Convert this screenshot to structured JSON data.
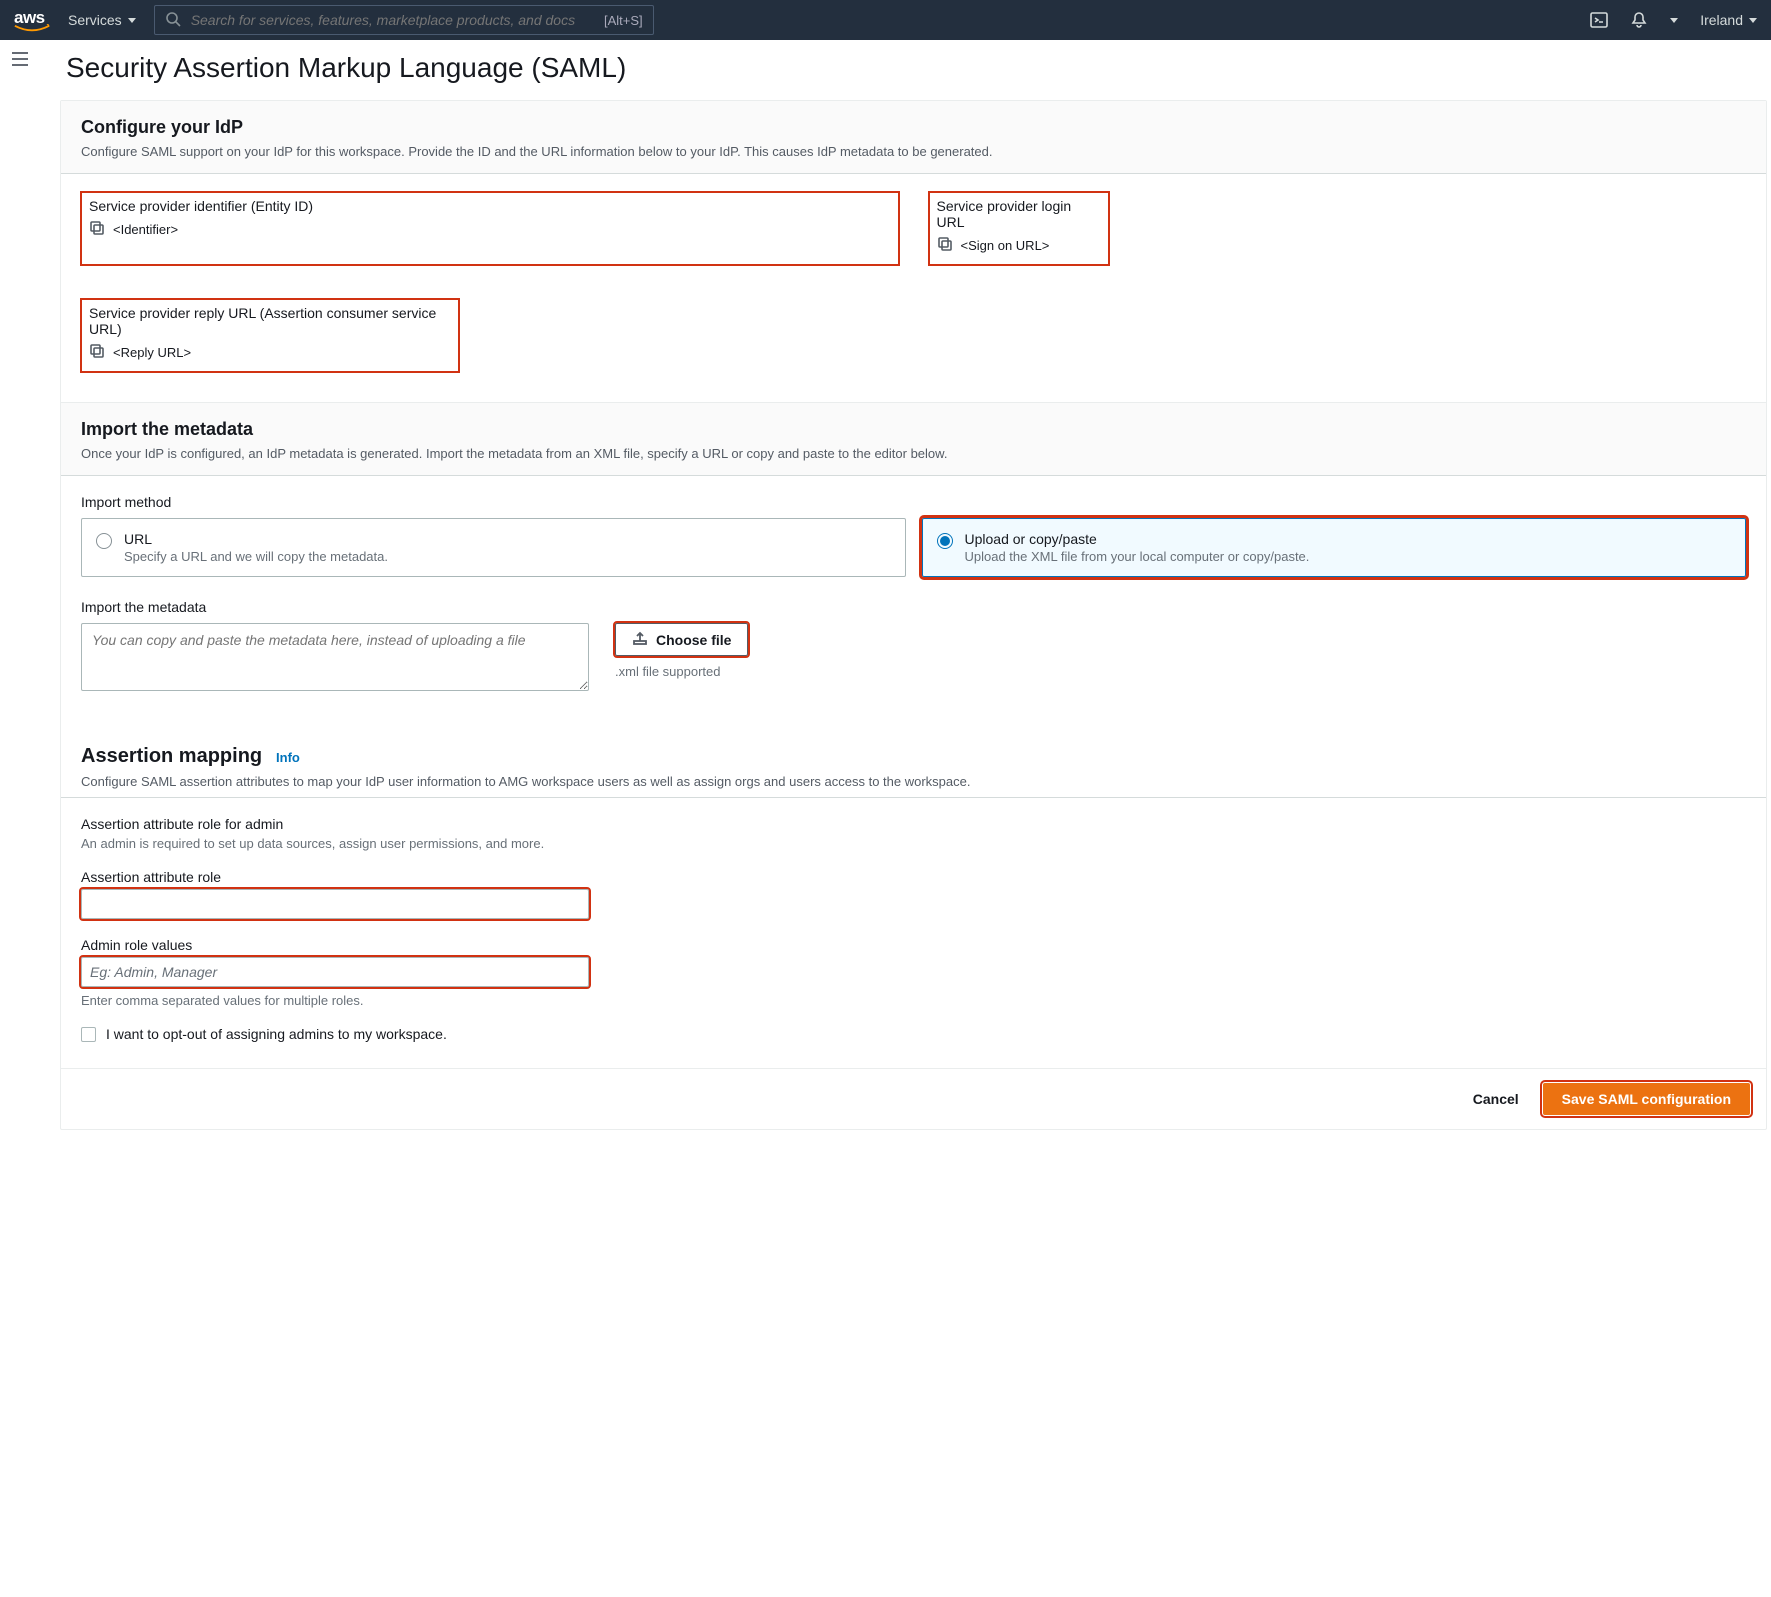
{
  "nav": {
    "services": "Services",
    "search_placeholder": "Search for services, features, marketplace products, and docs",
    "shortcut": "[Alt+S]",
    "region": "Ireland"
  },
  "page": {
    "title": "Security Assertion Markup Language (SAML)"
  },
  "configure": {
    "heading": "Configure your IdP",
    "sub": "Configure SAML support on your IdP for this workspace. Provide the ID and the URL information below to your IdP. This causes IdP metadata to be generated.",
    "entity_label": "Service provider identifier (Entity ID)",
    "entity_value": "<Identifier>",
    "login_label": "Service provider login URL",
    "login_value": "<Sign on URL>",
    "reply_label": "Service provider reply URL (Assertion consumer service URL)",
    "reply_value": "<Reply URL>"
  },
  "import": {
    "heading": "Import the metadata",
    "sub": "Once your IdP is configured, an IdP metadata is generated. Import the metadata from an XML file, specify a URL or copy and paste to the editor below.",
    "method_label": "Import method",
    "url_title": "URL",
    "url_desc": "Specify a URL and we will copy the metadata.",
    "upload_title": "Upload or copy/paste",
    "upload_desc": "Upload the XML file from your local computer or copy/paste.",
    "textarea_label": "Import the metadata",
    "textarea_placeholder": "You can copy and paste the metadata here, instead of uploading a file",
    "choose_file": "Choose file",
    "file_hint": ".xml file supported"
  },
  "assertion": {
    "heading": "Assertion mapping",
    "info": "Info",
    "sub": "Configure SAML assertion attributes to map your IdP user information to AMG workspace users as well as assign orgs and users access to the workspace.",
    "admin_label": "Assertion attribute role for admin",
    "admin_desc": "An admin is required to set up data sources, assign user permissions, and more.",
    "role_label": "Assertion attribute role",
    "values_label": "Admin role values",
    "values_placeholder": "Eg: Admin, Manager",
    "values_hint": "Enter comma separated values for multiple roles.",
    "optout": "I want to opt-out of assigning admins to my workspace."
  },
  "footer": {
    "cancel": "Cancel",
    "save": "Save SAML configuration"
  }
}
